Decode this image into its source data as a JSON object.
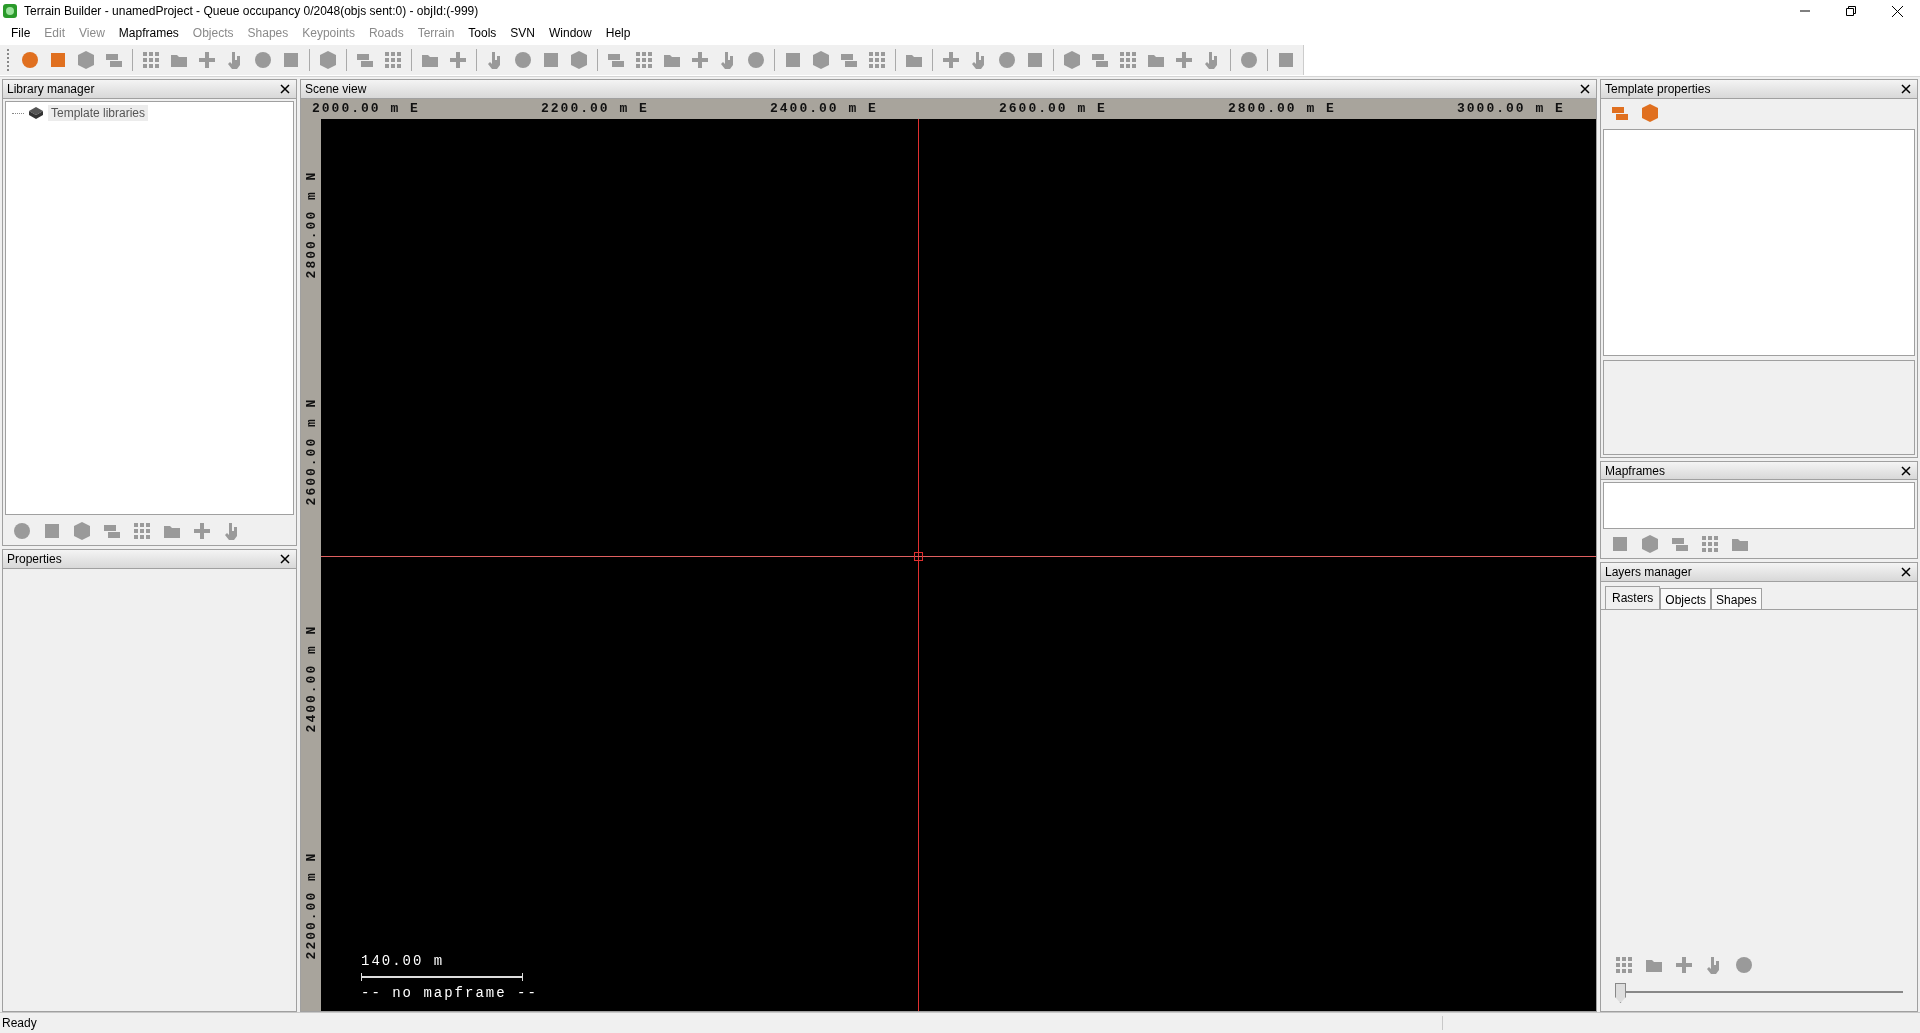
{
  "window": {
    "title": "Terrain Builder - unamedProject - Queue occupancy 0/2048(objs sent:0) - objId:(-999)"
  },
  "menu": [
    {
      "label": "File",
      "disabled": false
    },
    {
      "label": "Edit",
      "disabled": true
    },
    {
      "label": "View",
      "disabled": true
    },
    {
      "label": "Mapframes",
      "disabled": false
    },
    {
      "label": "Objects",
      "disabled": true
    },
    {
      "label": "Shapes",
      "disabled": true
    },
    {
      "label": "Keypoints",
      "disabled": true
    },
    {
      "label": "Roads",
      "disabled": true
    },
    {
      "label": "Terrain",
      "disabled": true
    },
    {
      "label": "Tools",
      "disabled": false
    },
    {
      "label": "SVN",
      "disabled": false
    },
    {
      "label": "Window",
      "disabled": false
    },
    {
      "label": "Help",
      "disabled": false
    }
  ],
  "toolbar": [
    [
      {
        "disabled": false
      },
      {
        "disabled": false
      },
      {
        "disabled": true
      },
      {
        "disabled": true
      }
    ],
    [
      {
        "disabled": true
      },
      {
        "disabled": true
      },
      {
        "disabled": true
      },
      {
        "disabled": true
      },
      {
        "disabled": true
      },
      {
        "disabled": true
      }
    ],
    [
      {
        "disabled": true
      }
    ],
    [
      {
        "disabled": true
      },
      {
        "disabled": true
      }
    ],
    [
      {
        "disabled": true
      },
      {
        "disabled": true
      }
    ],
    [
      {
        "disabled": true
      },
      {
        "disabled": true
      },
      {
        "disabled": true
      },
      {
        "disabled": true
      }
    ],
    [
      {
        "disabled": true
      },
      {
        "disabled": true
      },
      {
        "disabled": true
      },
      {
        "disabled": true
      },
      {
        "disabled": true
      },
      {
        "disabled": true
      }
    ],
    [
      {
        "disabled": true
      },
      {
        "disabled": true
      },
      {
        "disabled": true
      },
      {
        "disabled": true
      }
    ],
    [
      {
        "disabled": true
      }
    ],
    [
      {
        "disabled": true
      },
      {
        "disabled": true
      },
      {
        "disabled": true
      },
      {
        "disabled": true
      }
    ],
    [
      {
        "disabled": true
      },
      {
        "disabled": true
      },
      {
        "disabled": true
      },
      {
        "disabled": true
      },
      {
        "disabled": true
      },
      {
        "disabled": true
      }
    ],
    [
      {
        "disabled": true
      }
    ],
    [
      {
        "disabled": true
      }
    ]
  ],
  "library_manager": {
    "title": "Library manager",
    "tree": [
      {
        "label": "Template libraries",
        "selected": true
      }
    ]
  },
  "properties": {
    "title": "Properties"
  },
  "scene_view": {
    "title": "Scene view",
    "x_ruler": [
      "2000.00 m E",
      "2200.00 m E",
      "2400.00 m E",
      "2600.00 m E",
      "2800.00 m E",
      "3000.00 m E"
    ],
    "y_ruler": [
      "2800.00 m N",
      "2600.00 m N",
      "2400.00 m N",
      "2200.00 m N"
    ],
    "scale_label": "140.00 m",
    "mapframe_label": "-- no mapframe --"
  },
  "template_properties": {
    "title": "Template properties"
  },
  "mapframes": {
    "title": "Mapframes"
  },
  "layers_manager": {
    "title": "Layers manager",
    "tabs": [
      {
        "label": "Rasters",
        "selected": true
      },
      {
        "label": "Objects",
        "selected": false
      },
      {
        "label": "Shapes",
        "selected": false
      }
    ],
    "opacity": {
      "level": 0
    }
  },
  "status_bar": {
    "text": "Ready"
  }
}
